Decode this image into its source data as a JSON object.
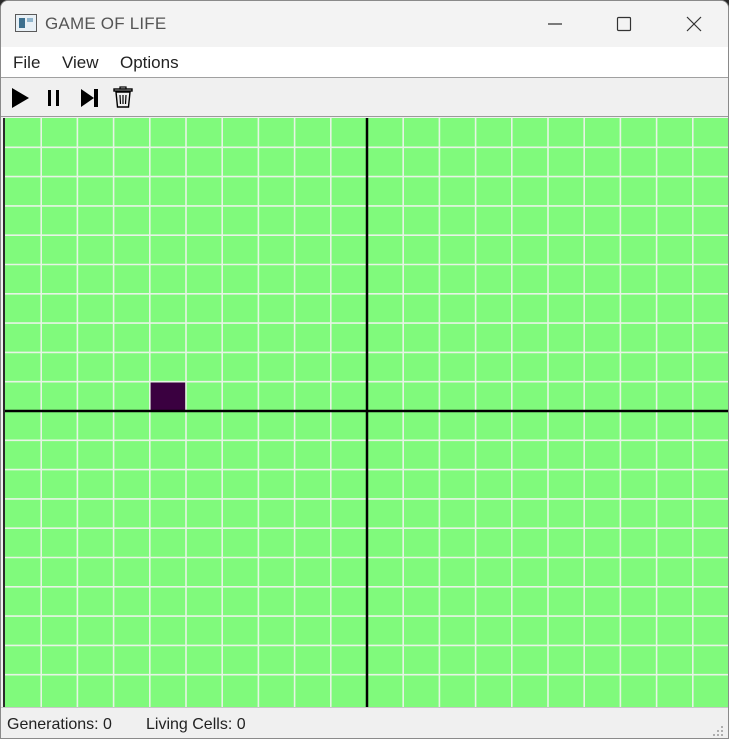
{
  "window": {
    "title": "GAME OF LIFE",
    "icon": "app-window-icon",
    "controls": [
      "minimize-icon",
      "maximize-icon",
      "close-icon"
    ]
  },
  "menu": {
    "file": "File",
    "view": "View",
    "options": "Options"
  },
  "toolbar": {
    "buttons": [
      "play-icon",
      "pause-icon",
      "step-icon",
      "trash-icon"
    ]
  },
  "grid": {
    "columns": 20,
    "rows": 20,
    "live_cells": [
      [
        4,
        9
      ]
    ],
    "colors": {
      "background": "#80fa7c",
      "grid_line": "#e6f4e4",
      "center_line": "#000000",
      "cell": "#3a0040"
    }
  },
  "status": {
    "generations_label": "Generations: 0",
    "living_label": "Living Cells: 0"
  }
}
